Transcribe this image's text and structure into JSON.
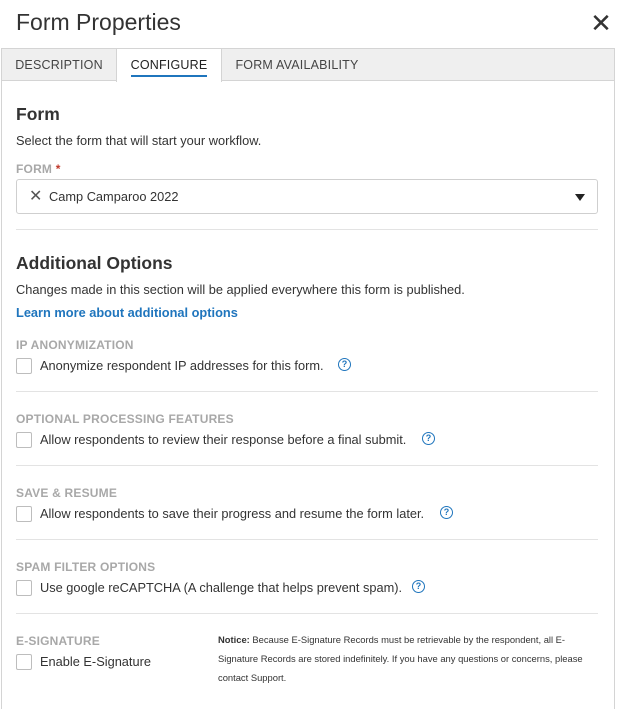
{
  "header": {
    "title": "Form Properties",
    "close_glyph": "✕"
  },
  "tabs": [
    {
      "label": "DESCRIPTION"
    },
    {
      "label": "CONFIGURE",
      "active": true
    },
    {
      "label": "FORM AVAILABILITY"
    }
  ],
  "form_section": {
    "heading": "Form",
    "description": "Select the form that will start your workflow.",
    "field_label": "FORM",
    "required_mark": "*",
    "selected_value": "Camp Camparoo 2022"
  },
  "additional": {
    "heading": "Additional Options",
    "description": "Changes made in this section will be applied everywhere this form is published.",
    "learn_more": "Learn more about additional options"
  },
  "options": [
    {
      "label": "IP ANONYMIZATION",
      "checkbox_text": "Anonymize respondent IP addresses for this form.",
      "checked": false
    },
    {
      "label": "OPTIONAL PROCESSING FEATURES",
      "checkbox_text": "Allow respondents to review their response before a final submit.",
      "checked": false
    },
    {
      "label": "SAVE & RESUME",
      "checkbox_text": "Allow respondents to save their progress and resume the form later.",
      "checked": false
    },
    {
      "label": "SPAM FILTER OPTIONS",
      "checkbox_text": "Use google reCAPTCHA (A challenge that helps prevent spam).",
      "checked": false
    }
  ],
  "esignature": {
    "label": "E-SIGNATURE",
    "checkbox_text": "Enable E-Signature",
    "checked": false,
    "notice_title": "Notice:",
    "notice_text": "Because E-Signature Records must be retrievable by the respondent, all E-Signature Records are stored indefinitely. If you have any questions or concerns, please contact Support."
  },
  "colors": {
    "accent": "#1f75bd",
    "required": "#c0392b",
    "section_label": "#a8a8a8"
  },
  "icons": {
    "close": "close-icon",
    "clear": "clear-icon",
    "dropdown": "chevron-down-icon",
    "help": "help-icon"
  }
}
